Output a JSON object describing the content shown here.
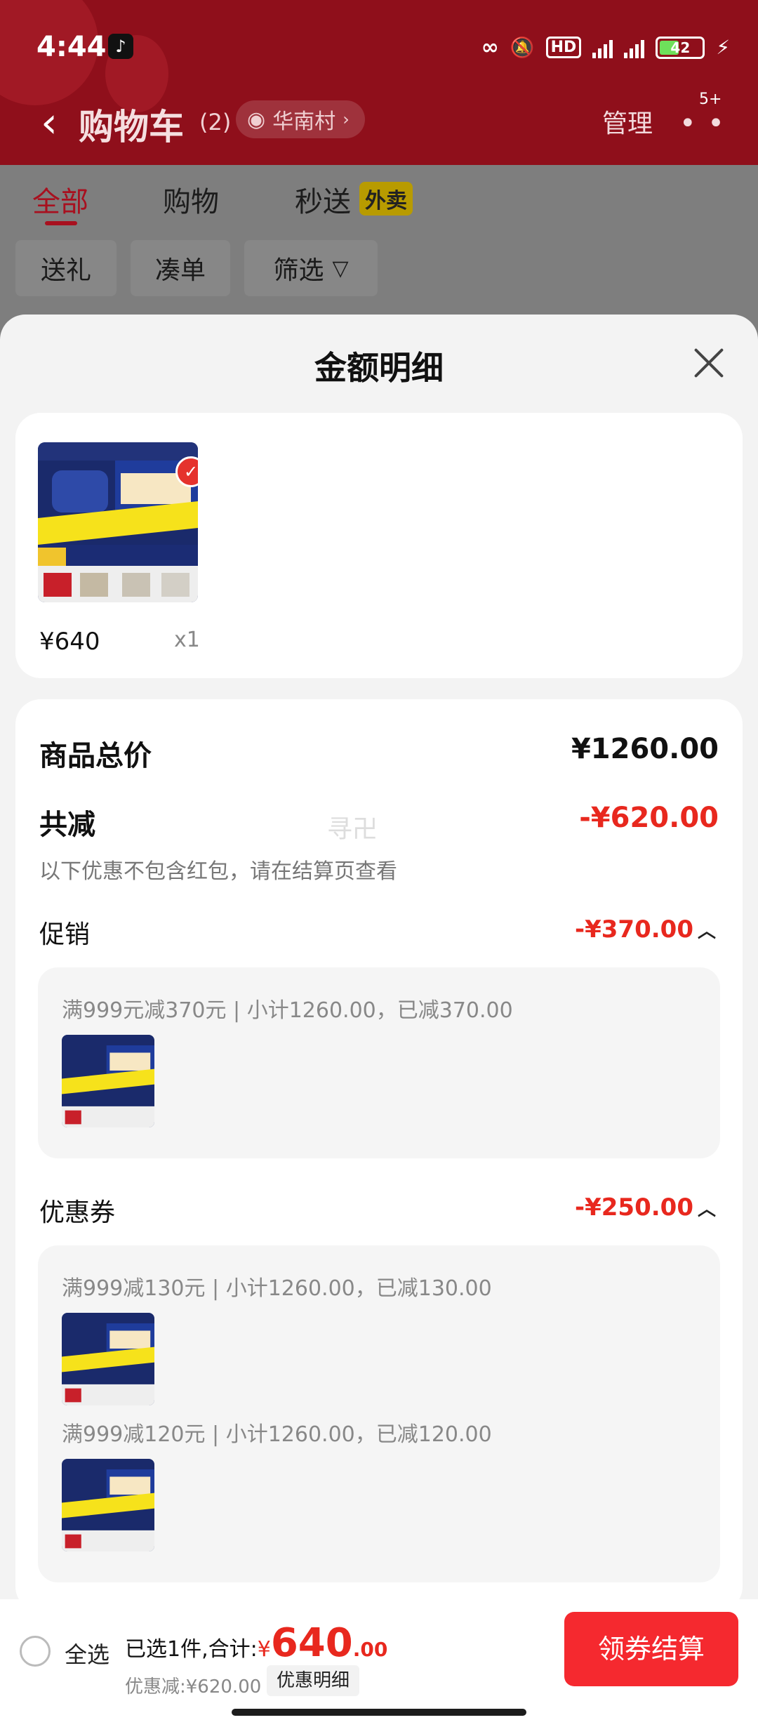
{
  "status": {
    "time": "4:44",
    "battery": "42"
  },
  "header": {
    "title": "购物车",
    "count": "(2)",
    "location": "华南村",
    "manage": "管理",
    "more_badge": "5+"
  },
  "tabs": [
    {
      "label": "全部"
    },
    {
      "label": "购物"
    },
    {
      "label": "秒送"
    }
  ],
  "takeout_badge": "外卖",
  "chips": [
    {
      "label": "送礼"
    },
    {
      "label": "凑单"
    },
    {
      "label": "筛选"
    }
  ],
  "sheet": {
    "title": "金额明细",
    "product": {
      "price": "¥640",
      "qty": "x1"
    },
    "total_label": "商品总价",
    "total_value": "¥1260.00",
    "reduce_label": "共减",
    "reduce_value": "-¥620.00",
    "note": "以下优惠不包含红包，请在结算页查看",
    "watermark": "寻卍",
    "promotion": {
      "label": "促销",
      "value": "-¥370.00",
      "rule": "满999元减370元 | 小计1260.00，已减370.00"
    },
    "coupon": {
      "label": "优惠券",
      "value": "-¥250.00",
      "rules": [
        "满999减130元 | 小计1260.00，已减130.00",
        "满999减120元 | 小计1260.00，已减120.00"
      ]
    }
  },
  "bottom": {
    "select_all": "全选",
    "selected_text": "已选1件,合计:",
    "currency": "¥",
    "total_int": "640",
    "total_dec": ".00",
    "discount": "优惠减:¥620.00",
    "detail_button": "优惠明细",
    "checkout": "领券结算"
  },
  "colors": {
    "accent": "#e8281e",
    "header_bg": "#8f0f1b",
    "checkout_bg": "#f5292f"
  }
}
